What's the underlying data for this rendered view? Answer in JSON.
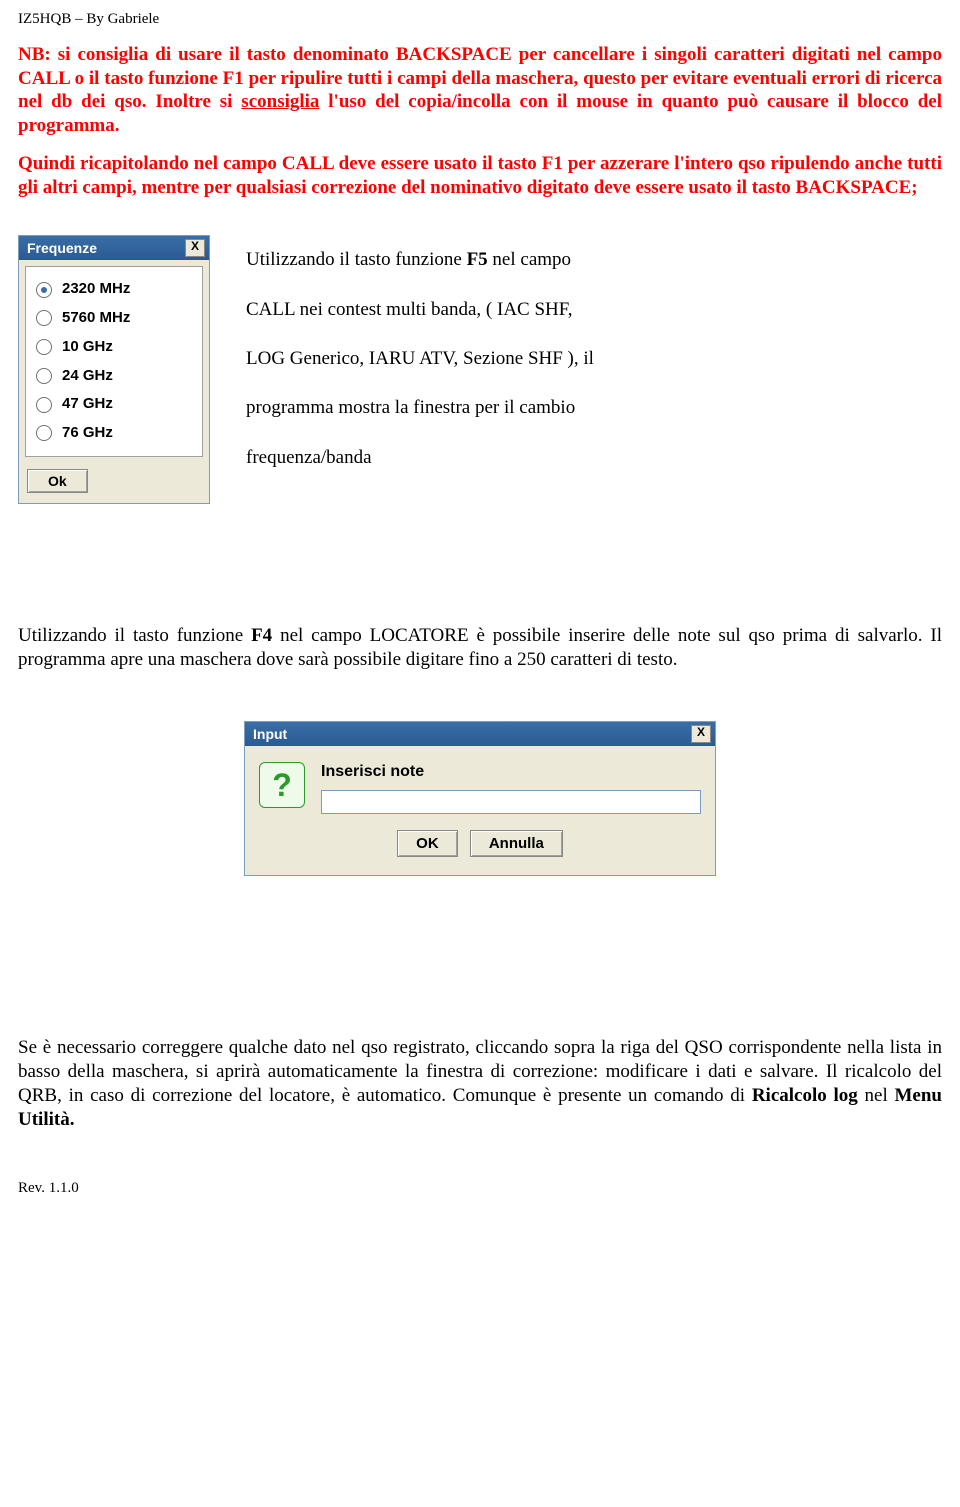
{
  "header": "IZ5HQB – By Gabriele",
  "nb_para": {
    "prefix": "NB: si consiglia di usare il tasto denominato BACKSPACE per cancellare i singoli caratteri digitati nel campo CALL o il tasto funzione F1 per ripulire tutti i campi della maschera, questo per evitare eventuali errori di ricerca nel db dei qso. Inoltre si ",
    "underline": "sconsiglia",
    "suffix": " l'uso del copia/incolla con il mouse in quanto può causare il blocco del programma."
  },
  "recap_para": "Quindi ricapitolando nel campo CALL deve essere usato il tasto F1 per azzerare l'intero qso ripulendo anche tutti gli altri campi, mentre per qualsiasi correzione del nominativo digitato deve essere usato il tasto BACKSPACE;",
  "freq_window": {
    "title": "Frequenze",
    "close": "X",
    "options": [
      "2320 MHz",
      "5760 MHz",
      "10 GHz",
      "24 GHz",
      "47 GHz",
      "76 GHz"
    ],
    "selected_index": 0,
    "ok": "Ok"
  },
  "f5_text": {
    "p1a": "Utilizzando il tasto funzione ",
    "p1b": "F5",
    "p1c": " nel campo",
    "p2": "CALL nei contest multi banda, ( IAC SHF,",
    "p3": "LOG Generico, IARU ATV, Sezione SHF ), il",
    "p4": "programma mostra la finestra per il cambio",
    "p5": "frequenza/banda"
  },
  "f4_para": {
    "a": "Utilizzando il tasto funzione ",
    "b": "F4",
    "c": " nel campo LOCATORE è possibile inserire delle note sul qso prima di salvarlo. Il programma apre una maschera dove sarà possibile digitare fino a 250 caratteri di testo."
  },
  "input_dialog": {
    "title": "Input",
    "close": "X",
    "icon": "?",
    "label": "Inserisci note",
    "ok": "OK",
    "cancel": "Annulla"
  },
  "final_para": {
    "a": "Se è necessario correggere qualche dato nel qso registrato, cliccando sopra la riga del QSO corrispondente nella lista in basso della maschera, si aprirà automaticamente la finestra di correzione: modificare i dati e salvare. Il ricalcolo del QRB, in caso di correzione del locatore, è automatico. Comunque è presente un comando di ",
    "b": "Ricalcolo log",
    "c": " nel ",
    "d": "Menu Utilità.",
    "e": ""
  },
  "rev": "Rev. 1.1.0"
}
